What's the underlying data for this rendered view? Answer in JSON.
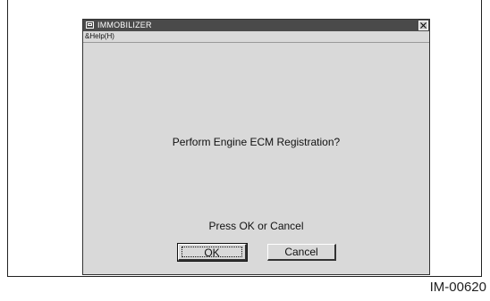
{
  "window": {
    "title": "IMMOBILIZER",
    "menu": "&Help(H)"
  },
  "dialog": {
    "question": "Perform Engine ECM Registration?",
    "prompt": "Press OK or Cancel",
    "ok_label": "OK",
    "cancel_label": "Cancel"
  },
  "figure": {
    "id": "IM-00620"
  },
  "icons": {
    "app": "app-window-icon",
    "close": "close-icon"
  },
  "colors": {
    "titlebar": "#4a4a4a",
    "window_bg": "#d9d9d9"
  }
}
